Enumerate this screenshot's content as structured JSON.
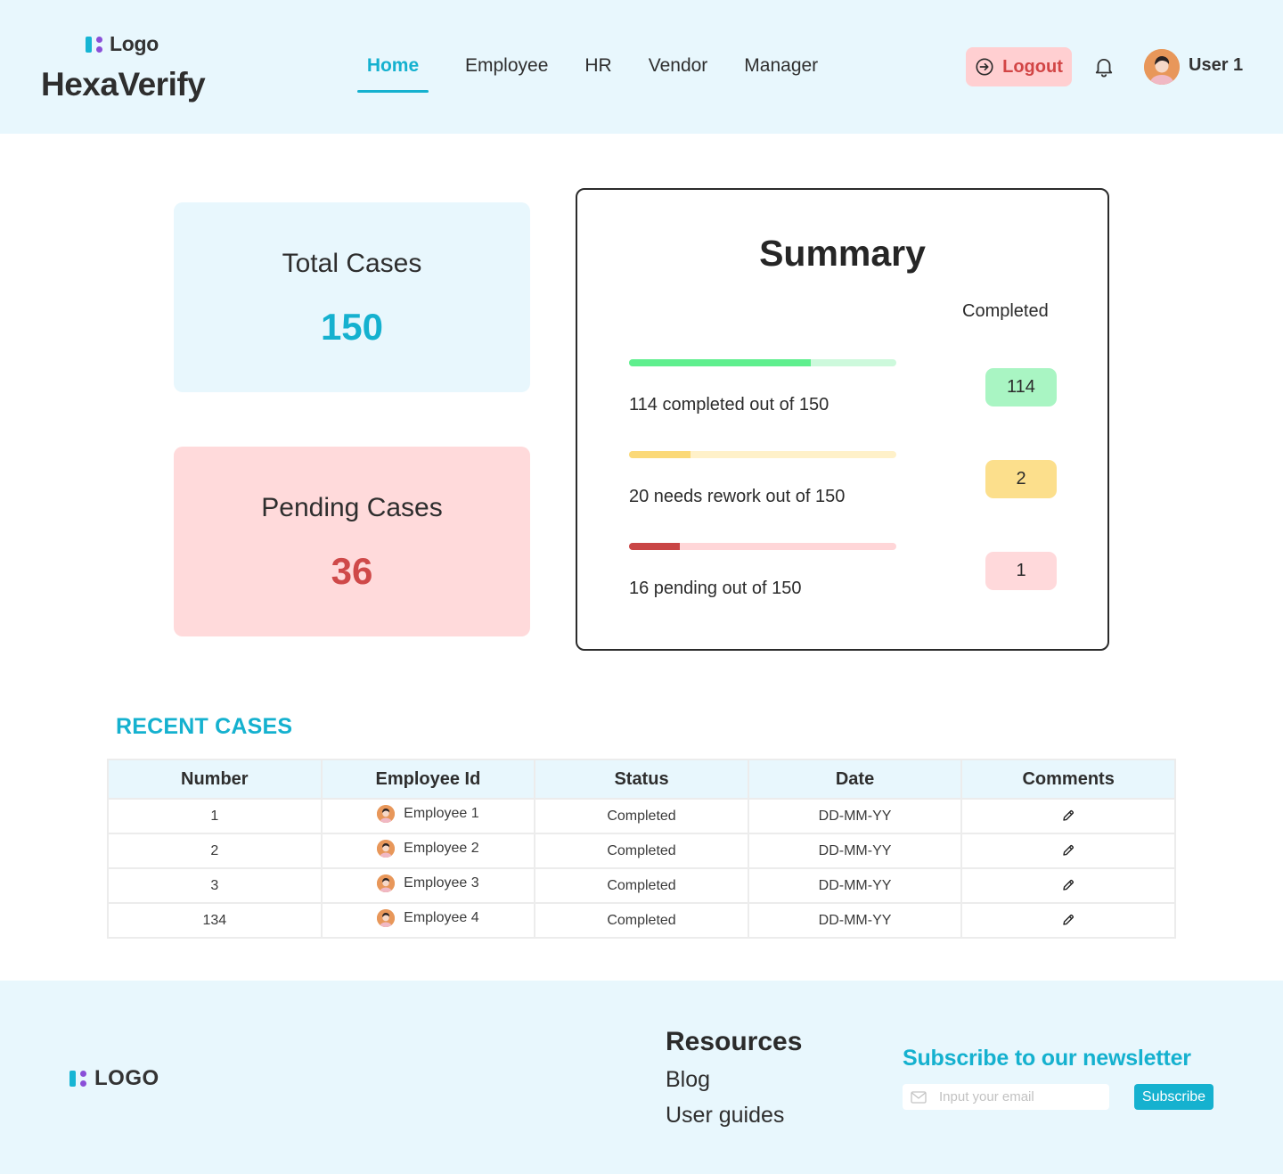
{
  "header": {
    "logo_text": "Logo",
    "app_title": "HexaVerify",
    "nav": [
      {
        "label": "Home",
        "active": true
      },
      {
        "label": "Employee",
        "active": false
      },
      {
        "label": "HR",
        "active": false
      },
      {
        "label": "Vendor",
        "active": false
      },
      {
        "label": "Manager",
        "active": false
      }
    ],
    "logout_label": "Logout",
    "user_name": "User 1",
    "icons": {
      "logout": "logout-icon",
      "notifications": "bell-icon",
      "avatar": "user-avatar"
    }
  },
  "stats": {
    "total": {
      "title": "Total Cases",
      "value": "150"
    },
    "pending": {
      "title": "Pending Cases",
      "value": "36"
    }
  },
  "summary": {
    "title": "Summary",
    "column_label": "Completed",
    "rows": [
      {
        "label": "114 completed out of 150",
        "count": "114",
        "progress": 0.68,
        "fill_color": "#5fef8e",
        "track_color": "#cdf9dc",
        "pill_color": "#a9f5c3"
      },
      {
        "label": "20 needs rework out of 150",
        "count": "2",
        "progress": 0.23,
        "fill_color": "#fbd978",
        "track_color": "#fff1c9",
        "pill_color": "#fcdf8c"
      },
      {
        "label": "16 pending out of 150",
        "count": "1",
        "progress": 0.19,
        "fill_color": "#c94545",
        "track_color": "#ffd6d8",
        "pill_color": "#ffd9db"
      }
    ]
  },
  "recent_cases": {
    "title": "RECENT CASES",
    "columns": [
      "Number",
      "Employee Id",
      "Status",
      "Date",
      "Comments"
    ],
    "rows": [
      {
        "number": "1",
        "employee": "Employee 1",
        "status": "Completed",
        "date": "DD-MM-YY",
        "comment_icon": "pencil-icon"
      },
      {
        "number": "2",
        "employee": "Employee 2",
        "status": "Completed",
        "date": "DD-MM-YY",
        "comment_icon": "pencil-icon"
      },
      {
        "number": "3",
        "employee": "Employee 3",
        "status": "Completed",
        "date": "DD-MM-YY",
        "comment_icon": "pencil-icon"
      },
      {
        "number": "134",
        "employee": "Employee 4",
        "status": "Completed",
        "date": "DD-MM-YY",
        "comment_icon": "pencil-icon"
      }
    ]
  },
  "footer": {
    "logo_text": "LOGO",
    "resources_title": "Resources",
    "links": [
      "Blog",
      "User guides"
    ],
    "newsletter_title": "Subscribe to our newsletter",
    "email_placeholder": "Input your email",
    "subscribe_label": "Subscribe"
  },
  "colors": {
    "accent": "#15b1cf",
    "header_bg": "#e8f7fd",
    "danger": "#cf4949",
    "logout_bg": "#ffcfd1"
  }
}
